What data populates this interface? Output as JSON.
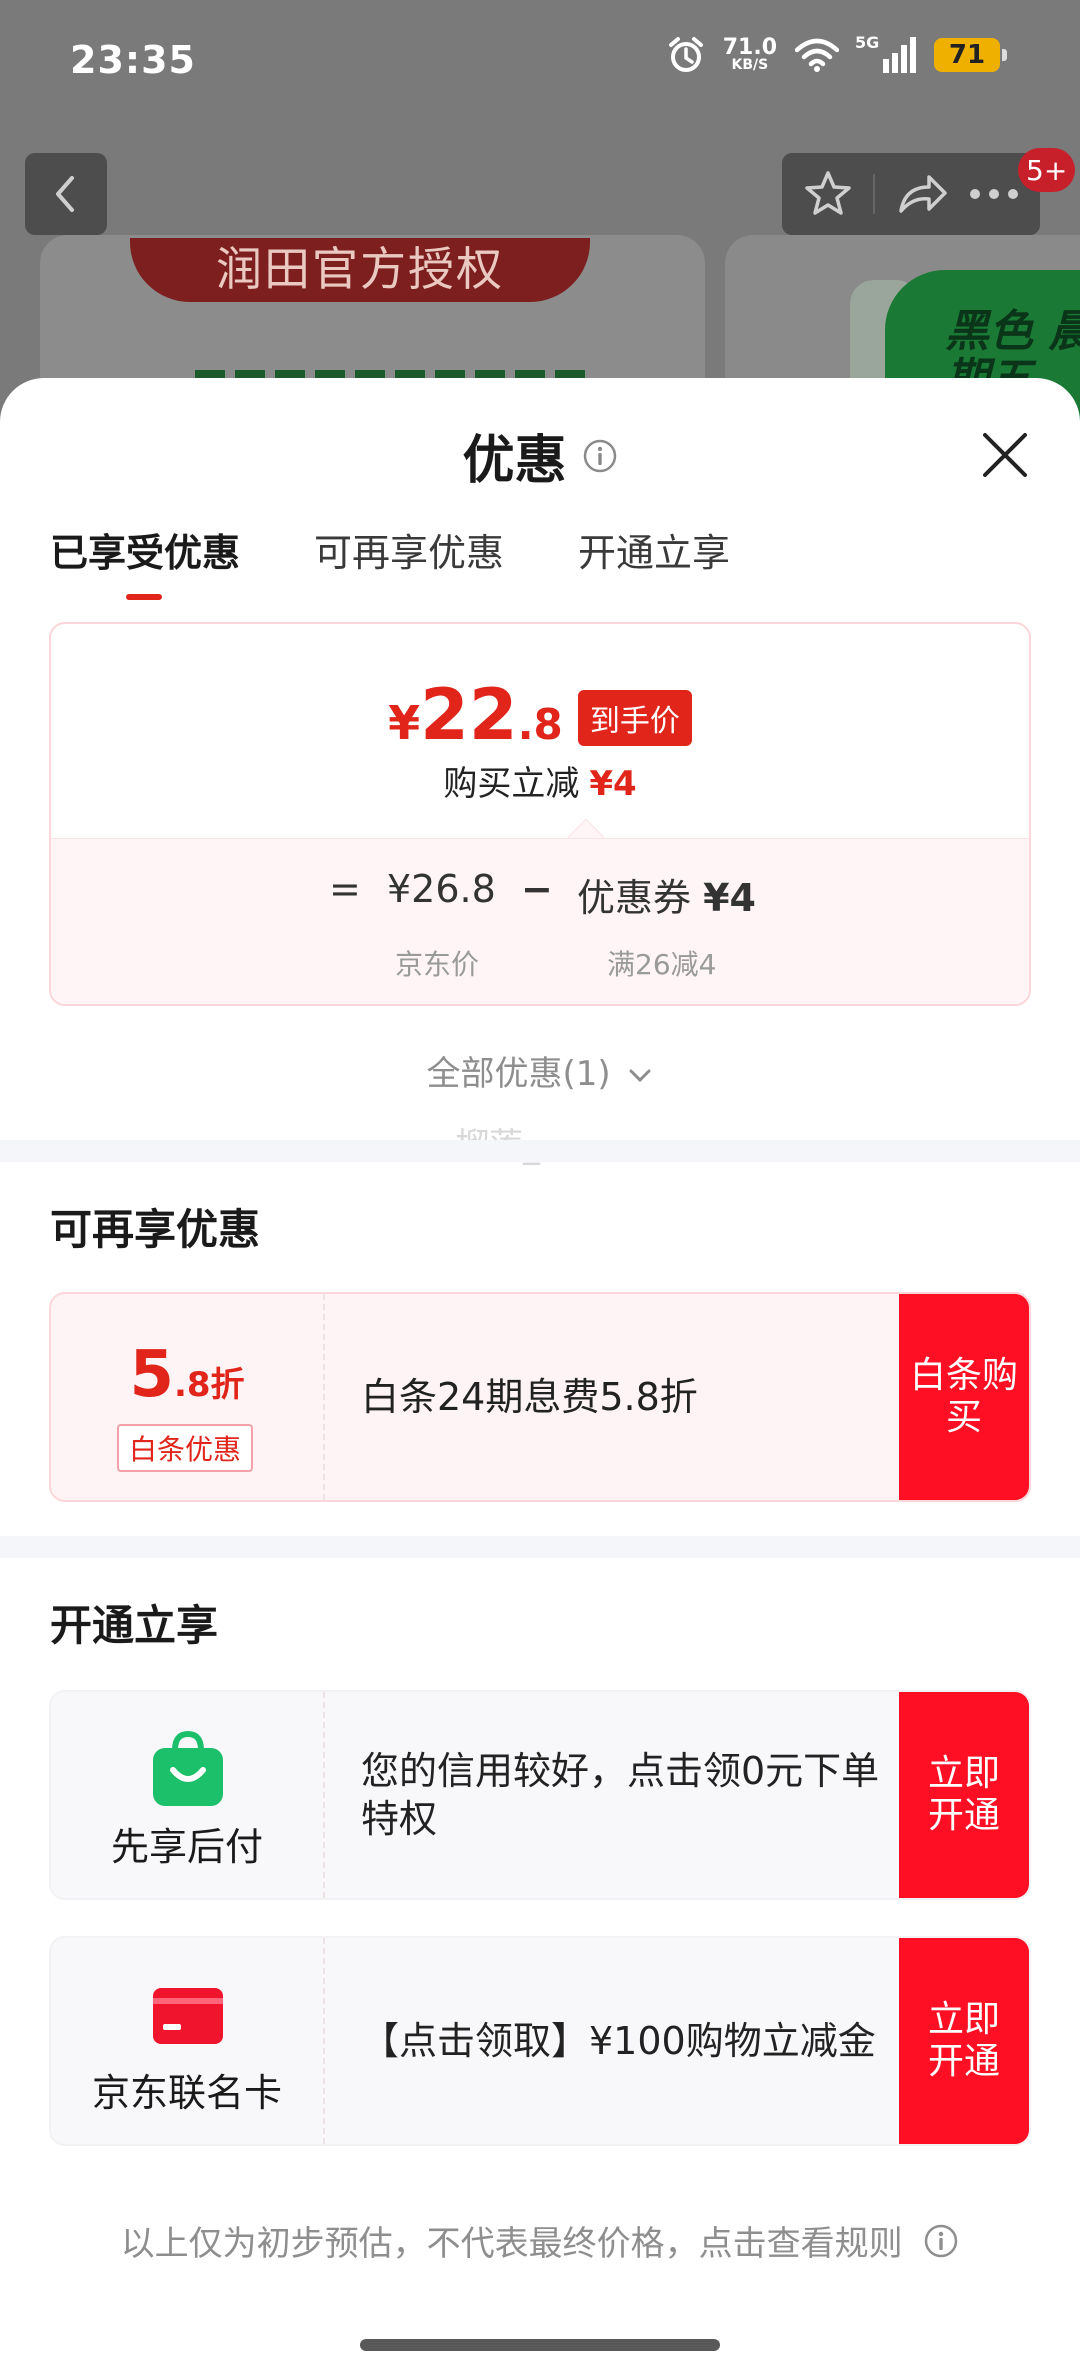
{
  "status_bar": {
    "time": "23:35",
    "net_speed": "71.0",
    "net_unit": "KB/S",
    "network": "5G",
    "battery": "71"
  },
  "background": {
    "banner_text": "润田官方授权",
    "green_banner_text": "黑色 晨期五",
    "badge": "5+"
  },
  "sheet": {
    "title": "优惠",
    "tabs": [
      {
        "label": "已享受优惠"
      },
      {
        "label": "可再享优惠"
      },
      {
        "label": "开通立享"
      }
    ],
    "price_card": {
      "currency": "¥",
      "price_int": "22",
      "price_dec": ".8",
      "tag": "到手价",
      "subtitle": "购买立减",
      "subtitle_amount": "¥4",
      "equals": "=",
      "jd_price": "¥26.8",
      "minus": "−",
      "coupon_label": "优惠券",
      "coupon_amount": "¥4",
      "jd_price_note": "京东价",
      "coupon_note": "满26减4"
    },
    "all_offers": "全部优惠(1)",
    "watermark": "榴莲_",
    "section_more": {
      "title": "可再享优惠",
      "card": {
        "discount_int": "5",
        "discount_dec": ".8折",
        "tag": "白条优惠",
        "text": "白条24期息费5.8折",
        "button": "白条购买"
      }
    },
    "section_open": {
      "title": "开通立享",
      "cards": [
        {
          "label": "先享后付",
          "text": "您的信用较好，点击领0元下单特权",
          "button": "立即开通",
          "icon": "shopping-bag-icon"
        },
        {
          "label": "京东联名卡",
          "text": "【点击领取】¥100购物立减金",
          "button": "立即开通",
          "icon": "credit-card-icon"
        }
      ]
    },
    "footer_note": "以上仅为初步预估，不代表最终价格，点击查看规则"
  },
  "colors": {
    "accent_red": "#e1251b",
    "button_red": "#ff0f23",
    "green_icon": "#1dc06a"
  }
}
